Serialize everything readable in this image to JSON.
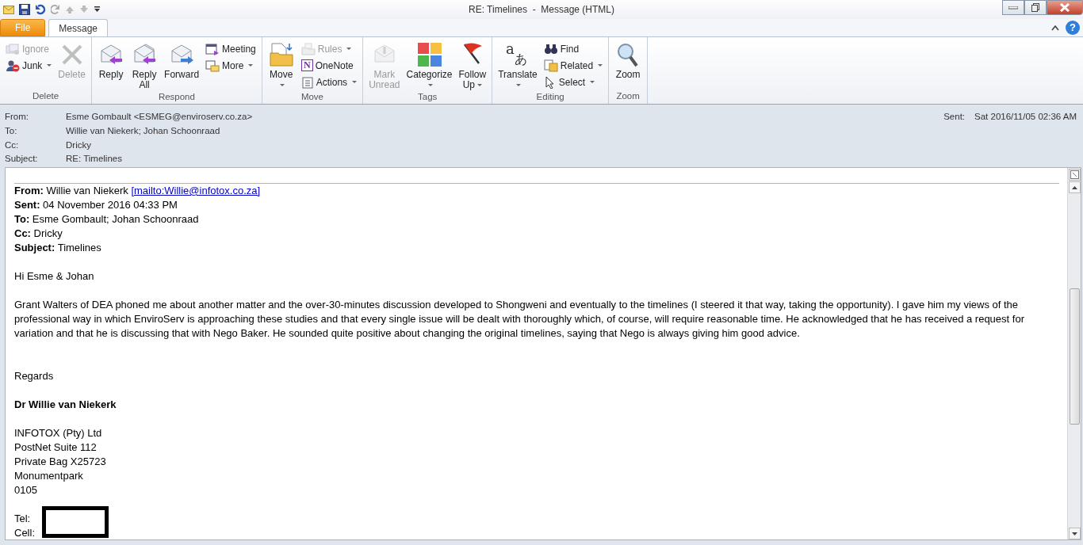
{
  "window": {
    "title": "RE: Timelines  -  Message (HTML)"
  },
  "tabs": [
    {
      "label": "File",
      "kind": "file",
      "selected": false
    },
    {
      "label": "Message",
      "kind": "tab",
      "selected": true
    }
  ],
  "help_button": {
    "glyph": "?"
  },
  "ribbon_groups": [
    {
      "name": "Delete",
      "items": [
        {
          "kind": "small",
          "label": "Ignore",
          "disabled": true,
          "dropdown": false
        },
        {
          "kind": "small",
          "label": "Junk",
          "disabled": false,
          "dropdown": true
        },
        {
          "kind": "large",
          "label": [
            "Delete"
          ],
          "disabled": true,
          "dropdown": false
        }
      ]
    },
    {
      "name": "Respond",
      "items": [
        {
          "kind": "large",
          "label": [
            "Reply"
          ],
          "disabled": false,
          "dropdown": false
        },
        {
          "kind": "large",
          "label": [
            "Reply",
            "All"
          ],
          "disabled": false,
          "dropdown": false
        },
        {
          "kind": "large",
          "label": [
            "Forward"
          ],
          "disabled": false,
          "dropdown": false
        },
        {
          "kind": "small",
          "label": "Meeting",
          "disabled": false,
          "dropdown": false
        },
        {
          "kind": "small",
          "label": "More",
          "disabled": false,
          "dropdown": true
        }
      ]
    },
    {
      "name": "Move",
      "items": [
        {
          "kind": "large",
          "label": [
            "Move"
          ],
          "disabled": false,
          "dropdown": true
        },
        {
          "kind": "small",
          "label": "Rules",
          "disabled": true,
          "dropdown": true
        },
        {
          "kind": "small",
          "label": "OneNote",
          "disabled": false,
          "dropdown": false,
          "icon_glyph": [
            "N"
          ]
        },
        {
          "kind": "small",
          "label": "Actions",
          "disabled": false,
          "dropdown": true
        }
      ]
    },
    {
      "name": "Tags",
      "items": [
        {
          "kind": "large",
          "label": [
            "Mark",
            "Unread"
          ],
          "disabled": true,
          "dropdown": false
        },
        {
          "kind": "large",
          "label": [
            "Categorize"
          ],
          "disabled": false,
          "dropdown": true
        },
        {
          "kind": "large",
          "label": [
            "Follow",
            "Up"
          ],
          "disabled": false,
          "dropdown": true
        }
      ]
    },
    {
      "name": "Editing",
      "items": [
        {
          "kind": "large",
          "label": [
            "Translate"
          ],
          "disabled": false,
          "dropdown": true,
          "icon_glyph": [
            "a",
            "あ"
          ]
        },
        {
          "kind": "small",
          "label": "Find",
          "disabled": false,
          "dropdown": false
        },
        {
          "kind": "small",
          "label": "Related",
          "disabled": false,
          "dropdown": true
        },
        {
          "kind": "small",
          "label": "Select",
          "disabled": false,
          "dropdown": true
        }
      ]
    },
    {
      "name": "Zoom",
      "items": [
        {
          "kind": "large",
          "label": [
            "Zoom"
          ],
          "disabled": false,
          "dropdown": false
        }
      ]
    }
  ],
  "header": {
    "fields": [
      {
        "label": "From:",
        "value": "Esme Gombault <ESMEG@enviroserv.co.za>"
      },
      {
        "label": "To:",
        "value": "Willie van Niekerk; Johan Schoonraad"
      },
      {
        "label": "Cc:",
        "value": "Dricky"
      },
      {
        "label": "Subject:",
        "value": "RE: Timelines"
      }
    ],
    "sent_label": "Sent:",
    "sent_value": "Sat 2016/11/05 02:36 AM"
  },
  "body": {
    "quoted_header": [
      {
        "text": "**From:** Willie van Niekerk ",
        "link": "[mailto:Willie@infotox.co.za]"
      },
      {
        "text": "**Sent:** 04 November 2016 04:33 PM"
      },
      {
        "text": "**To:** Esme Gombault; Johan Schoonraad"
      },
      {
        "text": "**Cc:** Dricky"
      },
      {
        "text": "**Subject:** Timelines"
      }
    ],
    "greeting": "Hi Esme & Johan",
    "paragraph": "Grant Walters of DEA phoned me about another matter and the over-30-minutes discussion developed to Shongweni and eventually to the timelines (I steered it that way, taking the opportunity).  I gave him my views of the professional way in which EnviroServ is approaching these studies and that every single issue will be dealt with thoroughly which, of course, will require reasonable time.  He acknowledged that he has received a request for variation and that he is discussing that with Nego Baker.  He sounded quite positive about changing the original timelines, saying that Nego is always giving him good advice.",
    "closing": "Regards",
    "signature_name": "Dr Willie van Niekerk",
    "address": [
      "INFOTOX (Pty) Ltd",
      "PostNet Suite 112",
      "Private Bag X25723",
      "Monumentpark",
      "0105"
    ],
    "contacts": [
      "Tel:",
      "Cell:"
    ]
  }
}
